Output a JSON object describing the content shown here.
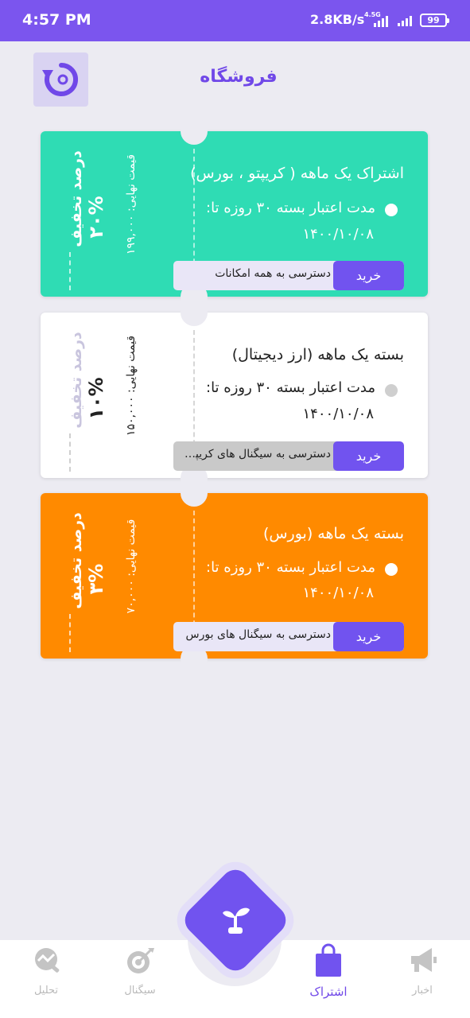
{
  "status_bar": {
    "time": "4:57 PM",
    "speed": "2.8KB/s",
    "network_type": "4.5G",
    "battery": "99"
  },
  "header": {
    "title": "فروشگاه",
    "refresh_icon": "refresh-icon"
  },
  "cards": [
    {
      "title": "اشتراک یک ماهه ( کریپتو ، بورس)",
      "validity": "مدت اعتبار بسته ۳۰ روزه تا:",
      "date": "۱۴۰۰/۱۰/۰۸",
      "feature": "دسترسی به همه امکانات",
      "buy_label": "خرید",
      "discount_label": "درصد تخفیف",
      "discount_value": "۲۰%",
      "final_price": "قیمت نهایی: ۱۹۹,۰۰۰",
      "bg_color": "#2fdcb4"
    },
    {
      "title": "بسته یک  ماهه (ارز دیجیتال)",
      "validity": "مدت اعتبار بسته ۳۰ روزه تا:",
      "date": "۱۴۰۰/۱۰/۰۸",
      "feature": "دسترسی به سیگنال های کریپت...",
      "buy_label": "خرید",
      "discount_label": "درصد تخفیف",
      "discount_value": "۱۰%",
      "final_price": "قیمت نهایی: ۱۵۰,۰۰۰",
      "bg_color": "#ffffff"
    },
    {
      "title": "بسته یک ماهه (بورس)",
      "validity": "مدت اعتبار بسته ۳۰ روزه تا:",
      "date": "۱۴۰۰/۱۰/۰۸",
      "feature": "دسترسی به سیگنال های بورس",
      "buy_label": "خرید",
      "discount_label": "درصد تخفیف",
      "discount_value": "۳%",
      "final_price": "قیمت نهایی: ۷۰,۰۰۰",
      "bg_color": "#ff8a00"
    }
  ],
  "bottom_nav": {
    "items": [
      {
        "label": "تحلیل",
        "icon": "analysis-icon",
        "active": false
      },
      {
        "label": "سیگنال",
        "icon": "target-icon",
        "active": false
      },
      {
        "label": "اشتراک",
        "icon": "shopping-bag-icon",
        "active": true
      },
      {
        "label": "اخبار",
        "icon": "megaphone-icon",
        "active": false
      }
    ],
    "center_icon": "sprout-icon"
  },
  "colors": {
    "primary": "#7153ef",
    "background": "#ecebf2"
  }
}
